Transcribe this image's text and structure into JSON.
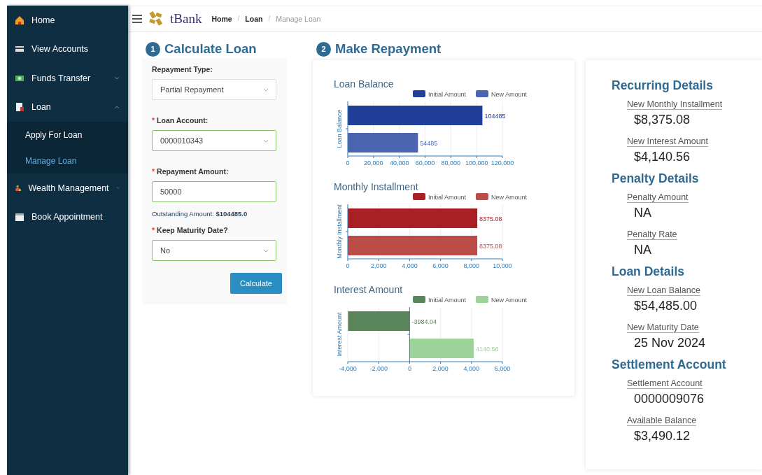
{
  "sidebar": {
    "items": [
      {
        "label": "Home",
        "kind": "home",
        "selected": false
      },
      {
        "label": "View Accounts",
        "kind": "card",
        "selected": false
      },
      {
        "label": "Funds Transfer",
        "kind": "money",
        "selected": false,
        "expanded": false
      },
      {
        "label": "Loan",
        "kind": "loan",
        "selected": false,
        "expanded": true,
        "children": [
          {
            "label": "Apply For Loan",
            "selected": false
          },
          {
            "label": "Manage Loan",
            "selected": true
          }
        ]
      },
      {
        "label": "Wealth Management",
        "kind": "wealth",
        "selected": false,
        "expanded": false
      },
      {
        "label": "Book Appointment",
        "kind": "calendar",
        "selected": false
      }
    ]
  },
  "header": {
    "logo": "tBank",
    "breadcrumb": [
      {
        "label": "Home",
        "current": false
      },
      {
        "label": "Loan",
        "current": false
      },
      {
        "label": "Manage Loan",
        "current": true
      }
    ],
    "separator": "/"
  },
  "calculate": {
    "step": "1",
    "required_mark": "*",
    "title": "Calculate Loan",
    "fields": [
      {
        "kind": "select",
        "label": "Repayment Type:",
        "required": false,
        "value": "Partial Repayment",
        "valid": false
      },
      {
        "kind": "select",
        "label": "Loan Account:",
        "required": true,
        "value": "0000010343",
        "valid": true
      },
      {
        "kind": "input",
        "label": "Repayment Amount:",
        "required": true,
        "value": "50000",
        "valid": true
      },
      {
        "kind": "note",
        "label": "Outstanding Amount:",
        "value": "$104485.0"
      },
      {
        "kind": "select",
        "label": "Keep Maturity Date?",
        "required": true,
        "value": "No",
        "valid": true
      }
    ],
    "button": "Calculate"
  },
  "repayment": {
    "step": "2",
    "title": "Make Repayment",
    "charts": [
      {
        "chart_data": {
          "type": "bar",
          "orientation": "horizontal",
          "title": "Loan Balance",
          "ylabel": "Loan Balance",
          "grid": true,
          "legend": true,
          "series": [
            {
              "name": "Initial Amount",
              "color": "#1f3f99",
              "values": [
                104485
              ]
            },
            {
              "name": "New Amount",
              "color": "#4a64b0",
              "values": [
                54485
              ]
            }
          ],
          "xlim": [
            0,
            120000
          ],
          "xticks": [
            {
              "value": 0,
              "label": "0"
            },
            {
              "value": 20000,
              "label": "20,000"
            },
            {
              "value": 40000,
              "label": "40,000"
            },
            {
              "value": 60000,
              "label": "60,000"
            },
            {
              "value": 80000,
              "label": "80,000"
            },
            {
              "value": 100000,
              "label": "100,000"
            },
            {
              "value": 120000,
              "label": "120,000"
            }
          ],
          "data_labels": true
        }
      },
      {
        "chart_data": {
          "type": "bar",
          "orientation": "horizontal",
          "title": "Monthly Installment",
          "ylabel": "Monthly Installment",
          "grid": true,
          "legend": true,
          "series": [
            {
              "name": "Initial Amount",
              "color": "#a81f24",
              "values": [
                8375.08
              ]
            },
            {
              "name": "New Amount",
              "color": "#bb4c48",
              "values": [
                8375.08
              ]
            }
          ],
          "xlim": [
            0,
            10000
          ],
          "xticks": [
            {
              "value": 0,
              "label": "0"
            },
            {
              "value": 2000,
              "label": "2,000"
            },
            {
              "value": 4000,
              "label": "4,000"
            },
            {
              "value": 6000,
              "label": "6,000"
            },
            {
              "value": 8000,
              "label": "8,000"
            },
            {
              "value": 10000,
              "label": "10,000"
            }
          ],
          "data_labels": true
        }
      },
      {
        "chart_data": {
          "type": "bar",
          "orientation": "horizontal",
          "title": "Interest Amount",
          "ylabel": "Interest Amount",
          "grid": true,
          "legend": true,
          "ref_lines": [
            {
              "axis": "x",
              "value": 0
            }
          ],
          "series": [
            {
              "name": "Initial Amount",
              "color": "#5a8459",
              "values": [
                -3984.04
              ]
            },
            {
              "name": "New Amount",
              "color": "#9dd39a",
              "values": [
                4140.56
              ]
            }
          ],
          "xlim": [
            -4000,
            6000
          ],
          "xticks": [
            {
              "value": -4000,
              "label": "-4,000"
            },
            {
              "value": -2000,
              "label": "-2,000"
            },
            {
              "value": 0,
              "label": "0"
            },
            {
              "value": 2000,
              "label": "2,000"
            },
            {
              "value": 4000,
              "label": "4,000"
            },
            {
              "value": 6000,
              "label": "6,000"
            }
          ],
          "data_labels": true
        }
      }
    ]
  },
  "details": [
    {
      "heading": "Recurring Details",
      "items": [
        {
          "label": "New Monthly Installment",
          "value": "$8,375.08"
        },
        {
          "label": "New Interest Amount",
          "value": "$4,140.56"
        }
      ]
    },
    {
      "heading": "Penalty Details",
      "items": [
        {
          "label": "Penalty Amount",
          "value": "NA"
        },
        {
          "label": "Penalty Rate",
          "value": "NA"
        }
      ]
    },
    {
      "heading": "Loan Details",
      "items": [
        {
          "label": "New Loan Balance",
          "value": "$54,485.00"
        },
        {
          "label": "New Maturity Date",
          "value": "25 Nov 2024"
        }
      ]
    },
    {
      "heading": "Settlement Account",
      "items": [
        {
          "label": "Settlement Account",
          "value": "0000009076"
        },
        {
          "label": "Available Balance",
          "value": "$3,490.12"
        }
      ]
    }
  ]
}
